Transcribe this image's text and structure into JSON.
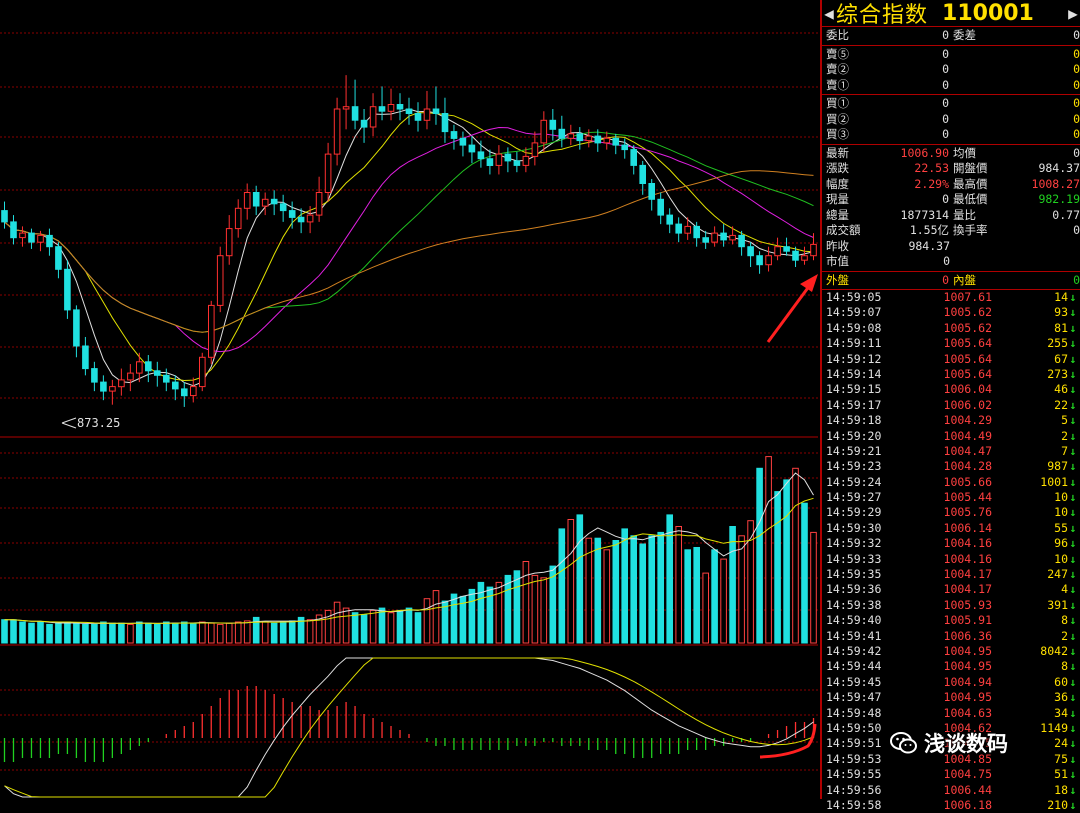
{
  "header": {
    "prev_arrow": "◀",
    "name": "综合指数",
    "code": "110001",
    "next_arrow": "▶"
  },
  "stats": {
    "weibi_label": "委比",
    "weibi_value": "0",
    "weicha_label": "委差",
    "weicha_value": "0",
    "sell": [
      {
        "label": "賣⑤",
        "price": "0",
        "vol": "0"
      },
      {
        "label": "賣②",
        "price": "0",
        "vol": "0"
      },
      {
        "label": "賣①",
        "price": "0",
        "vol": "0"
      }
    ],
    "buy": [
      {
        "label": "買①",
        "price": "0",
        "vol": "0"
      },
      {
        "label": "買②",
        "price": "0",
        "vol": "0"
      },
      {
        "label": "買③",
        "price": "0",
        "vol": "0"
      }
    ],
    "quote": [
      {
        "l1": "最新",
        "v1": "1006.90",
        "c1": "red",
        "l2": "均價",
        "v2": "0",
        "c2": "white"
      },
      {
        "l1": "漲跌",
        "v1": "22.53",
        "c1": "red",
        "l2": "開盤價",
        "v2": "984.37",
        "c2": "white"
      },
      {
        "l1": "幅度",
        "v1": "2.29%",
        "c1": "red",
        "l2": "最高價",
        "v2": "1008.27",
        "c2": "red"
      },
      {
        "l1": "現量",
        "v1": "0",
        "c1": "white",
        "l2": "最低價",
        "v2": "982.19",
        "c2": "green"
      },
      {
        "l1": "總量",
        "v1": "1877314",
        "c1": "white",
        "l2": "量比",
        "v2": "0.77",
        "c2": "white"
      },
      {
        "l1": "成交額",
        "v1": "1.55亿",
        "c1": "white",
        "l2": "換手率",
        "v2": "0",
        "c2": "white"
      },
      {
        "l1": "昨收",
        "v1": "984.37",
        "c1": "white",
        "l2": "",
        "v2": "",
        "c2": "white"
      },
      {
        "l1": "市值",
        "v1": "0",
        "c1": "white",
        "l2": "",
        "v2": "",
        "c2": "white"
      }
    ],
    "waipan_label": "外盤",
    "waipan_value": "0",
    "neipan_label": "內盤",
    "neipan_value": "0"
  },
  "ticks": [
    {
      "time": "14:59:05",
      "price": "1007.61",
      "vol": "14"
    },
    {
      "time": "14:59:07",
      "price": "1005.62",
      "vol": "93"
    },
    {
      "time": "14:59:08",
      "price": "1005.62",
      "vol": "81"
    },
    {
      "time": "14:59:11",
      "price": "1005.64",
      "vol": "255"
    },
    {
      "time": "14:59:12",
      "price": "1005.64",
      "vol": "67"
    },
    {
      "time": "14:59:14",
      "price": "1005.64",
      "vol": "273"
    },
    {
      "time": "14:59:15",
      "price": "1006.04",
      "vol": "46"
    },
    {
      "time": "14:59:17",
      "price": "1006.02",
      "vol": "22"
    },
    {
      "time": "14:59:18",
      "price": "1004.29",
      "vol": "5"
    },
    {
      "time": "14:59:20",
      "price": "1004.49",
      "vol": "2"
    },
    {
      "time": "14:59:21",
      "price": "1004.47",
      "vol": "7"
    },
    {
      "time": "14:59:23",
      "price": "1004.28",
      "vol": "987"
    },
    {
      "time": "14:59:24",
      "price": "1005.66",
      "vol": "1001"
    },
    {
      "time": "14:59:27",
      "price": "1005.44",
      "vol": "10"
    },
    {
      "time": "14:59:29",
      "price": "1005.76",
      "vol": "10"
    },
    {
      "time": "14:59:30",
      "price": "1006.14",
      "vol": "55"
    },
    {
      "time": "14:59:32",
      "price": "1004.16",
      "vol": "96"
    },
    {
      "time": "14:59:33",
      "price": "1004.16",
      "vol": "10"
    },
    {
      "time": "14:59:35",
      "price": "1004.17",
      "vol": "247"
    },
    {
      "time": "14:59:36",
      "price": "1004.17",
      "vol": "4"
    },
    {
      "time": "14:59:38",
      "price": "1005.93",
      "vol": "391"
    },
    {
      "time": "14:59:40",
      "price": "1005.91",
      "vol": "8"
    },
    {
      "time": "14:59:41",
      "price": "1006.36",
      "vol": "2"
    },
    {
      "time": "14:59:42",
      "price": "1004.95",
      "vol": "8042"
    },
    {
      "time": "14:59:44",
      "price": "1004.95",
      "vol": "8"
    },
    {
      "time": "14:59:45",
      "price": "1004.94",
      "vol": "60"
    },
    {
      "time": "14:59:47",
      "price": "1004.95",
      "vol": "36"
    },
    {
      "time": "14:59:48",
      "price": "1004.63",
      "vol": "34"
    },
    {
      "time": "14:59:50",
      "price": "1004.62",
      "vol": "1149"
    },
    {
      "time": "14:59:51",
      "price": "1004.55",
      "vol": "24"
    },
    {
      "time": "14:59:53",
      "price": "1004.85",
      "vol": "75"
    },
    {
      "time": "14:59:55",
      "price": "1004.75",
      "vol": "51"
    },
    {
      "time": "14:59:56",
      "price": "1006.44",
      "vol": "18"
    },
    {
      "time": "14:59:58",
      "price": "1006.18",
      "vol": "210"
    }
  ],
  "tick_arrow": "↓",
  "watermark": "浅谈数码",
  "chart_data": {
    "type": "candlestick",
    "low_annotation": "873.25",
    "low_value": 873.25,
    "price_range": [
      865,
      1040
    ],
    "candles": [
      [
        960,
        955,
        964,
        952
      ],
      [
        955,
        948,
        958,
        945
      ],
      [
        948,
        950,
        953,
        944
      ],
      [
        950,
        946,
        952,
        943
      ],
      [
        946,
        949,
        951,
        942
      ],
      [
        949,
        944,
        952,
        940
      ],
      [
        944,
        934,
        946,
        930
      ],
      [
        934,
        916,
        938,
        912
      ],
      [
        916,
        900,
        918,
        895
      ],
      [
        900,
        890,
        904,
        887
      ],
      [
        890,
        884,
        893,
        880
      ],
      [
        884,
        880,
        887,
        876
      ],
      [
        880,
        882,
        885,
        874
      ],
      [
        882,
        885,
        890,
        878
      ],
      [
        885,
        888,
        892,
        880
      ],
      [
        888,
        893,
        897,
        884
      ],
      [
        893,
        889,
        896,
        884
      ],
      [
        889,
        887,
        893,
        882
      ],
      [
        887,
        884,
        890,
        880
      ],
      [
        884,
        881,
        887,
        876
      ],
      [
        881,
        878,
        884,
        873
      ],
      [
        878,
        882,
        886,
        875
      ],
      [
        882,
        895,
        897,
        880
      ],
      [
        895,
        918,
        920,
        892
      ],
      [
        918,
        940,
        944,
        915
      ],
      [
        940,
        952,
        958,
        936
      ],
      [
        952,
        961,
        965,
        948
      ],
      [
        961,
        968,
        972,
        956
      ],
      [
        968,
        962,
        971,
        958
      ],
      [
        962,
        965,
        968,
        958
      ],
      [
        965,
        963,
        969,
        958
      ],
      [
        963,
        960,
        967,
        955
      ],
      [
        960,
        957,
        964,
        952
      ],
      [
        957,
        955,
        961,
        950
      ],
      [
        955,
        958,
        962,
        950
      ],
      [
        958,
        968,
        975,
        955
      ],
      [
        968,
        985,
        990,
        964
      ],
      [
        985,
        1005,
        1010,
        980
      ],
      [
        1005,
        1006,
        1020,
        996
      ],
      [
        1006,
        1000,
        1018,
        996
      ],
      [
        1000,
        997,
        1005,
        990
      ],
      [
        997,
        1006,
        1012,
        993
      ],
      [
        1006,
        1004,
        1015,
        1000
      ],
      [
        1004,
        1007,
        1014,
        1000
      ],
      [
        1007,
        1005,
        1012,
        1000
      ],
      [
        1005,
        1003,
        1010,
        998
      ],
      [
        1003,
        1000,
        1008,
        995
      ],
      [
        1000,
        1005,
        1013,
        996
      ],
      [
        1005,
        1003,
        1015,
        998
      ],
      [
        1003,
        995,
        1010,
        990
      ],
      [
        995,
        992,
        998,
        987
      ],
      [
        992,
        989,
        995,
        984
      ],
      [
        989,
        986,
        993,
        981
      ],
      [
        986,
        983,
        991,
        979
      ],
      [
        983,
        980,
        987,
        976
      ],
      [
        980,
        985,
        989,
        976
      ],
      [
        985,
        982,
        988,
        977
      ],
      [
        982,
        980,
        986,
        977
      ],
      [
        980,
        984,
        988,
        977
      ],
      [
        984,
        990,
        995,
        980
      ],
      [
        990,
        1000,
        1004,
        986
      ],
      [
        1000,
        996,
        1005,
        991
      ],
      [
        996,
        992,
        1002,
        988
      ],
      [
        992,
        994,
        998,
        989
      ],
      [
        994,
        991,
        997,
        987
      ],
      [
        991,
        993,
        996,
        988
      ],
      [
        993,
        990,
        996,
        986
      ],
      [
        990,
        992,
        995,
        987
      ],
      [
        992,
        989,
        994,
        985
      ],
      [
        989,
        987,
        992,
        983
      ],
      [
        987,
        980,
        989,
        976
      ],
      [
        980,
        972,
        982,
        967
      ],
      [
        972,
        965,
        974,
        960
      ],
      [
        965,
        958,
        968,
        954
      ],
      [
        958,
        954,
        961,
        950
      ],
      [
        954,
        950,
        957,
        946
      ],
      [
        950,
        953,
        957,
        947
      ],
      [
        953,
        948,
        955,
        944
      ],
      [
        948,
        946,
        951,
        943
      ],
      [
        946,
        950,
        953,
        944
      ],
      [
        950,
        947,
        954,
        944
      ],
      [
        947,
        949,
        953,
        945
      ],
      [
        949,
        944,
        951,
        940
      ],
      [
        944,
        940,
        946,
        935
      ],
      [
        940,
        936,
        942,
        932
      ],
      [
        936,
        940,
        944,
        933
      ],
      [
        940,
        944,
        948,
        938
      ],
      [
        944,
        942,
        948,
        940
      ],
      [
        942,
        938,
        944,
        935
      ],
      [
        938,
        940,
        944,
        936
      ],
      [
        940,
        945,
        950,
        938
      ]
    ],
    "volumes": [
      20,
      20,
      18,
      17,
      18,
      16,
      17,
      18,
      17,
      16,
      16,
      18,
      17,
      17,
      16,
      18,
      17,
      16,
      18,
      17,
      18,
      17,
      18,
      17,
      16,
      17,
      18,
      19,
      22,
      18,
      17,
      18,
      19,
      22,
      20,
      24,
      28,
      35,
      30,
      26,
      24,
      28,
      30,
      26,
      28,
      30,
      26,
      38,
      45,
      36,
      42,
      40,
      46,
      52,
      48,
      52,
      58,
      62,
      70,
      58,
      56,
      66,
      98,
      106,
      110,
      90,
      90,
      80,
      88,
      98,
      92,
      85,
      92,
      95,
      110,
      100,
      80,
      82,
      60,
      80,
      72,
      100,
      92,
      105,
      150,
      160,
      130,
      140,
      150,
      120,
      95
    ],
    "vol_up": [
      false,
      false,
      false,
      false,
      false,
      false,
      false,
      false,
      false,
      false,
      false,
      false,
      false,
      false,
      true,
      false,
      false,
      false,
      false,
      false,
      false,
      false,
      true,
      true,
      true,
      true,
      true,
      true,
      false,
      true,
      false,
      false,
      false,
      false,
      true,
      true,
      true,
      true,
      true,
      false,
      false,
      true,
      false,
      true,
      false,
      false,
      false,
      true,
      true,
      false,
      false,
      false,
      false,
      false,
      false,
      true,
      false,
      false,
      true,
      true,
      true,
      false,
      false,
      true,
      false,
      true,
      false,
      true,
      false,
      false,
      false,
      false,
      false,
      false,
      false,
      true,
      false,
      false,
      true,
      false,
      true,
      false,
      true,
      true,
      false,
      true,
      false,
      false,
      true,
      false,
      true
    ],
    "macd": [
      -6,
      -6,
      -5,
      -5,
      -5,
      -5,
      -4,
      -4,
      -5,
      -6,
      -6,
      -6,
      -5,
      -4,
      -3,
      -2,
      -1,
      0,
      1,
      2,
      3,
      4,
      6,
      8,
      10,
      12,
      12,
      13,
      13,
      12,
      11,
      10,
      9,
      8,
      8,
      7,
      7,
      8,
      9,
      8,
      6,
      5,
      4,
      3,
      2,
      1,
      0,
      -1,
      -2,
      -2,
      -3,
      -3,
      -3,
      -3,
      -3,
      -3,
      -3,
      -2,
      -2,
      -2,
      -1,
      -1,
      -2,
      -2,
      -2,
      -3,
      -3,
      -3,
      -4,
      -4,
      -5,
      -5,
      -5,
      -4,
      -4,
      -4,
      -3,
      -3,
      -3,
      -2,
      -2,
      -1,
      -1,
      -1,
      0,
      1,
      2,
      3,
      4,
      4,
      5
    ]
  }
}
